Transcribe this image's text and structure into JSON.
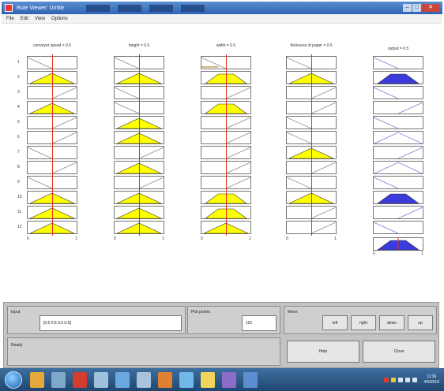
{
  "window": {
    "title": "Rule Viewer: Untitled (FIS)",
    "controls": {
      "minimize": "–",
      "maximize": "□",
      "close": "✕"
    }
  },
  "menu": [
    "File",
    "Edit",
    "View",
    "Options"
  ],
  "columns": [
    {
      "title": "conveyor speed = 0.5",
      "kind": "input"
    },
    {
      "title": "height = 0.5",
      "kind": "input"
    },
    {
      "title": "width = 0.5",
      "kind": "input"
    },
    {
      "title": "thickness of paper = 0.5",
      "kind": "input"
    },
    {
      "title": "output = 0.5",
      "kind": "output"
    }
  ],
  "row_numbers": [
    "1",
    "2",
    "3",
    "4",
    "5",
    "6",
    "7",
    "8",
    "9",
    "10",
    "11",
    "12"
  ],
  "tick_labels": [
    "0",
    "1"
  ],
  "colors": {
    "input_fill": "#ffff00",
    "output_fill": "#3b3bdc",
    "marker": "#e0301e",
    "mf_line": "#8a8a8a"
  },
  "mf_grid": [
    [
      "slope-down-lines",
      "slope-down-lines",
      "slope-down-lines-flat",
      "slope-down-lines",
      "slope-down-lines"
    ],
    [
      "tri-filled",
      "tri-filled",
      "trap-filled",
      "tri-filled",
      "trap-filled"
    ],
    [
      "slope-up-lines",
      "slope-down-lines",
      "slope-up-lines",
      "slope-up-lines",
      "slope-down-lines"
    ],
    [
      "tri-filled",
      "slope-down-lines",
      "trap-filled",
      "slope-up-lines",
      "slope-up-lines"
    ],
    [
      "slope-up-lines",
      "tri-filled",
      "slope-up-lines",
      "slope-down-lines",
      "slope-down-lines"
    ],
    [
      "slope-up-lines",
      "tri-filled",
      "slope-up-lines",
      "slope-down-lines",
      "tri-lines"
    ],
    [
      "slope-down-lines",
      "slope-up-lines",
      "slope-up-lines",
      "tri-filled",
      "slope-up-lines"
    ],
    [
      "slope-up-lines",
      "tri-filled",
      "slope-up-lines",
      "slope-up-lines",
      "tri-lines"
    ],
    [
      "slope-down-lines",
      "slope-up-lines",
      "slope-up-lines",
      "slope-down-lines",
      "slope-down-lines"
    ],
    [
      "tri-filled",
      "tri-filled",
      "trap-filled",
      "tri-filled",
      "trap-filled"
    ],
    [
      "tri-filled",
      "tri-filled",
      "trap-filled",
      "slope-up-lines",
      "slope-up-lines"
    ],
    [
      "tri-filled",
      "tri-filled",
      "tri-filled",
      "slope-up-lines",
      "slope-down-lines"
    ]
  ],
  "aggregate": {
    "shape": "trap-filled"
  },
  "controls": {
    "input_label": "Input:",
    "input_value": "[0.5 0.5 0.5 0.5]",
    "plot_points_label": "Plot points:",
    "plot_points_value": "101",
    "move_label": "Move:",
    "move_buttons": [
      "left",
      "right",
      "down",
      "up"
    ],
    "status_label": "Ready",
    "help_button": "Help",
    "close_button": "Close"
  },
  "taskbar": {
    "time": "11:36",
    "date": "4/5/2016"
  }
}
